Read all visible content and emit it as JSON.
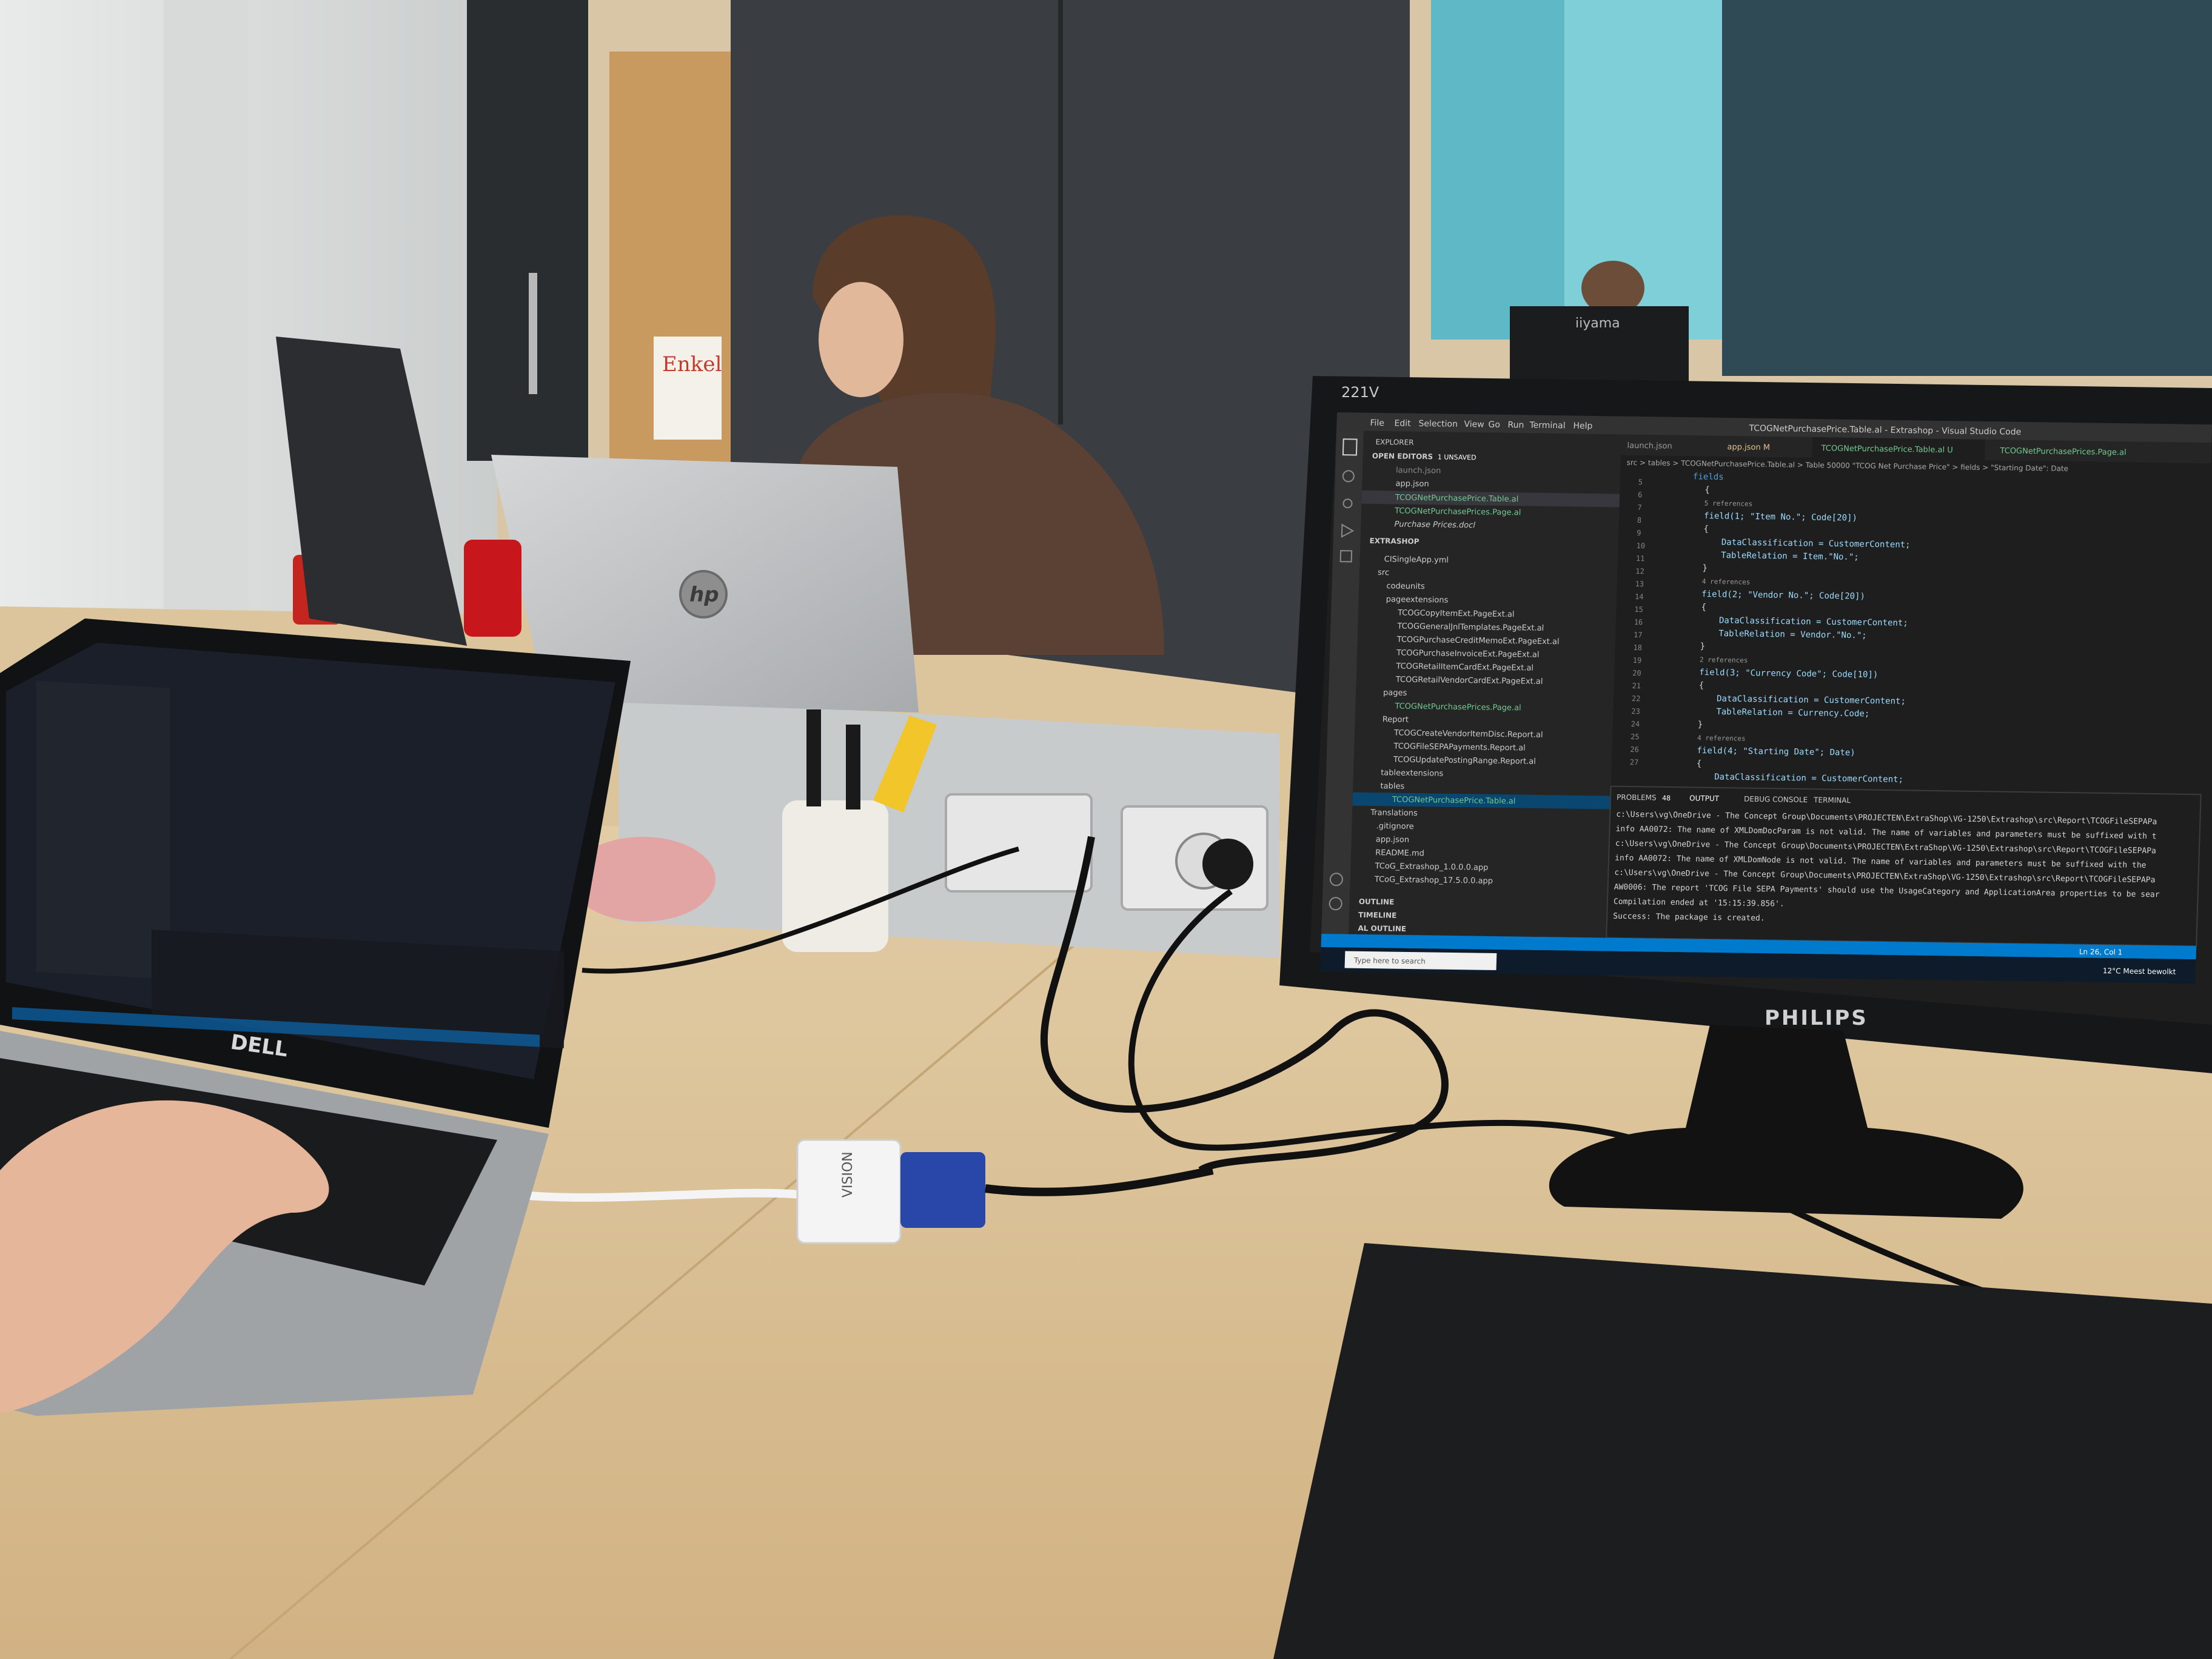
{
  "brands": {
    "laptop_left": "DELL",
    "laptop_center": "hp",
    "monitor_right": "PHILIPS",
    "monitor_right_model": "221V",
    "monitor_back": "iiyama",
    "adapter": "VISION"
  },
  "vscode": {
    "window_title": "TCOGNetPurchasePrice.Table.al - Extrashop - Visual Studio Code",
    "menu": [
      "File",
      "Edit",
      "Selection",
      "View",
      "Go",
      "Run",
      "Terminal",
      "Help"
    ],
    "tabs": [
      "launch.json",
      "app.json M",
      "TCOGNetPurchasePrice.Table.al U",
      "TCOGNetPurchasePrices.Page.al"
    ],
    "breadcrumb": "src > tables > TCOGNetPurchasePrice.Table.al > Table 50000 \"TCOG Net Purchase Price\" > fields > \"Starting Date\": Date",
    "explorer": {
      "header": "EXPLORER",
      "open_editors": "OPEN EDITORS",
      "unsaved": "1 UNSAVED",
      "open_files": [
        "launch.json",
        "app.json",
        "TCOGNetPurchasePrice.Table.al",
        "TCOGNetPurchasePrices.Page.al",
        "Purchase Prices.docl"
      ],
      "project": "EXTRASHOP",
      "files": [
        "CISingleApp.yml",
        "src",
        "codeunits",
        "pageextensions",
        "TCOGCopyItemExt.PageExt.al",
        "TCOGGeneralJnlTemplates.PageExt.al",
        "TCOGPurchaseCreditMemoExt.PageExt.al",
        "TCOGPurchaseInvoiceExt.PageExt.al",
        "TCOGRetailItemCardExt.PageExt.al",
        "TCOGRetailVendorCardExt.PageExt.al",
        "pages",
        "TCOGNetPurchasePrices.Page.al",
        "Report",
        "TCOGCreateVendorItemDisc.Report.al",
        "TCOGFileSEPAPayments.Report.al",
        "TCOGUpdatePostingRange.Report.al",
        "tableextensions",
        "tables",
        "TCOGNetPurchasePrice.Table.al",
        "Translations",
        ".gitignore",
        "app.json",
        "README.md",
        "TCoG_Extrashop_1.0.0.0.app",
        "TCoG_Extrashop_17.5.0.0.app"
      ],
      "outline": "OUTLINE",
      "timeline": "TIMELINE",
      "al_outline": "AL OUTLINE"
    },
    "line_numbers": [
      "5",
      "6",
      "7",
      "8",
      "9",
      "10",
      "11",
      "12",
      "13",
      "14",
      "15",
      "16",
      "17",
      "18",
      "19",
      "20",
      "21",
      "22",
      "23",
      "24",
      "25",
      "26",
      "27"
    ],
    "code": [
      "fields",
      "{",
      "5 references",
      "field(1; \"Item No.\"; Code[20])",
      "{",
      "DataClassification = CustomerContent;",
      "TableRelation = Item.\"No.\";",
      "}",
      "4 references",
      "field(2; \"Vendor No.\"; Code[20])",
      "{",
      "DataClassification = CustomerContent;",
      "TableRelation = Vendor.\"No.\";",
      "}",
      "2 references",
      "field(3; \"Currency Code\"; Code[10])",
      "{",
      "DataClassification = CustomerContent;",
      "TableRelation = Currency.Code;",
      "}",
      "4 references",
      "field(4; \"Starting Date\"; Date)",
      "{",
      "DataClassification = CustomerContent;"
    ],
    "panel_tabs": [
      "PROBLEMS",
      "OUTPUT",
      "DEBUG CONSOLE",
      "TERMINAL"
    ],
    "problems_count": "48",
    "output_lines": [
      "c:\\Users\\vg\\OneDrive - The Concept Group\\Documents\\PROJECTEN\\ExtraShop\\VG-1250\\Extrashop\\src\\Report\\TCOGFileSEPAPa",
      "info AA0072: The name of XMLDomDocParam is not valid. The name of variables and parameters must be suffixed with t",
      "c:\\Users\\vg\\OneDrive - The Concept Group\\Documents\\PROJECTEN\\ExtraShop\\VG-1250\\Extrashop\\src\\Report\\TCOGFileSEPAPa",
      "info AA0072: The name of XMLDomNode is not valid. The name of variables and parameters must be suffixed with the",
      "c:\\Users\\vg\\OneDrive - The Concept Group\\Documents\\PROJECTEN\\ExtraShop\\VG-1250\\Extrashop\\src\\Report\\TCOGFileSEPAPa",
      "AW0006: The report 'TCOG File SEPA Payments' should use the UsageCategory and ApplicationArea properties to be sear",
      "Compilation ended at '15:15:39.856'.",
      "Success: The package is created."
    ],
    "status_bar": "Ln 26, Col 1",
    "taskbar_search": "Type here to search",
    "weather": "12°C  Meest bewolkt"
  },
  "whiteboard_note": "Enkel",
  "colors": {
    "vscode_bg": "#1e1e1e",
    "vscode_sidebar": "#252526",
    "vscode_status": "#007acc",
    "desk": "#d8bf95",
    "wall_teal": "#5fb8c6"
  }
}
